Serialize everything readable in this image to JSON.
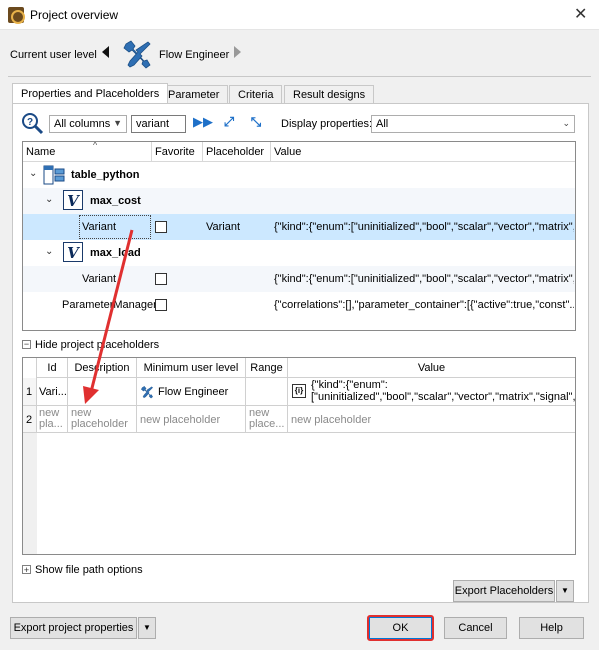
{
  "window": {
    "title": "Project overview",
    "close_glyph": "✕"
  },
  "user_level": {
    "label": "Current user level",
    "value": "Flow Engineer"
  },
  "tabs": [
    {
      "label": "Properties and Placeholders"
    },
    {
      "label": "Parameter"
    },
    {
      "label": "Criteria"
    },
    {
      "label": "Result designs"
    }
  ],
  "toolbar": {
    "filter_column": "All columns",
    "search_value": "variant",
    "display_label": "Display properties:",
    "display_value": "All"
  },
  "tree": {
    "columns": [
      "Name",
      "Favorite",
      "Placeholder",
      "Value"
    ],
    "rows": [
      {
        "name": "table_python"
      },
      {
        "name": "max_cost"
      },
      {
        "name": "Variant",
        "placeholder": "Variant",
        "value": "{\"kind\":{\"enum\":[\"uninitialized\",\"bool\",\"scalar\",\"vector\",\"matrix\",..."
      },
      {
        "name": "max_load"
      },
      {
        "name": "Variant",
        "placeholder": "",
        "value": "{\"kind\":{\"enum\":[\"uninitialized\",\"bool\",\"scalar\",\"vector\",\"matrix\",..."
      },
      {
        "name": "ParameterManager",
        "placeholder": "",
        "value": "{\"correlations\":[],\"parameter_container\":[{\"active\":true,\"const\"..."
      }
    ]
  },
  "placeholders": {
    "toggle_label": "Hide project placeholders",
    "toggle_glyph": "−",
    "columns": [
      "Id",
      "Description",
      "Minimum user level",
      "Range",
      "Value"
    ],
    "rows": [
      {
        "num": "1",
        "id": "Vari...",
        "description": "",
        "level": "Flow Engineer",
        "range": "",
        "value": "{\"kind\":{\"enum\":\n[\"uninitialized\",\"bool\",\"scalar\",\"vector\",\"matrix\",\"signal\",..."
      },
      {
        "num": "2",
        "id": "new pla...",
        "description": "new placeholder",
        "level": "new placeholder",
        "range": "new place...",
        "value": "new placeholder"
      }
    ]
  },
  "file_path": {
    "toggle_label": "Show file path options",
    "toggle_glyph": "+"
  },
  "buttons": {
    "export_placeholders": "Export Placeholders",
    "export_properties": "Export project properties",
    "ok": "OK",
    "cancel": "Cancel",
    "help": "Help"
  },
  "colors": {
    "accent": "#0078d7",
    "selection": "#cce8ff",
    "annotation": "#e03030"
  }
}
